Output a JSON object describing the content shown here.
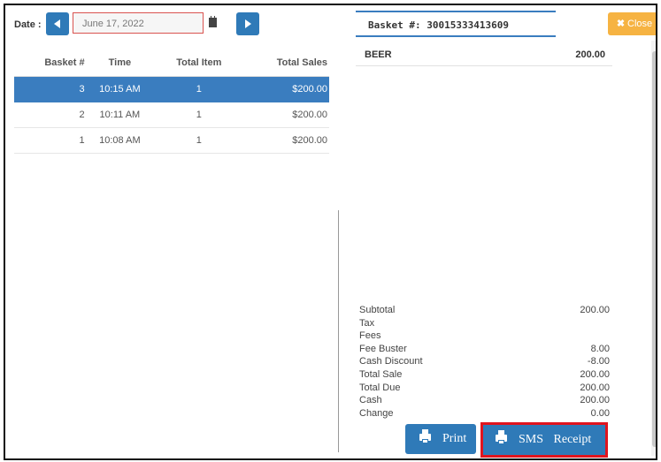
{
  "date_bar": {
    "label": "Date :",
    "date_value": "June 17, 2022"
  },
  "table": {
    "headers": [
      "Basket #",
      "Time",
      "Total Item",
      "Total Sales"
    ],
    "rows": [
      {
        "basket": "3",
        "time": "10:15 AM",
        "items": "1",
        "sales": "$200.00",
        "selected": true
      },
      {
        "basket": "2",
        "time": "10:11 AM",
        "items": "1",
        "sales": "$200.00",
        "selected": false
      },
      {
        "basket": "1",
        "time": "10:08 AM",
        "items": "1",
        "sales": "$200.00",
        "selected": false
      }
    ]
  },
  "basket": {
    "title": "Basket #: 30015333413609",
    "close_label": "Close",
    "items": [
      {
        "name": "BEER",
        "price": "200.00"
      }
    ]
  },
  "summary": [
    {
      "label": "Subtotal",
      "value": "200.00"
    },
    {
      "label": "Tax",
      "value": ""
    },
    {
      "label": "Fees",
      "value": ""
    },
    {
      "label": "Fee Buster",
      "value": "8.00"
    },
    {
      "label": "Cash Discount",
      "value": "-8.00"
    },
    {
      "label": "Total Sale",
      "value": "200.00"
    },
    {
      "label": "Total Due",
      "value": "200.00"
    },
    {
      "label": "Cash",
      "value": "200.00"
    },
    {
      "label": "Change",
      "value": "0.00"
    }
  ],
  "actions": {
    "print_label": "Print",
    "sms_label": "SMS Receipt"
  },
  "colors": {
    "primary": "#2f7ab8",
    "selected_row": "#3a7dbf",
    "close": "#f6b342",
    "highlight_border": "#e0141e"
  }
}
